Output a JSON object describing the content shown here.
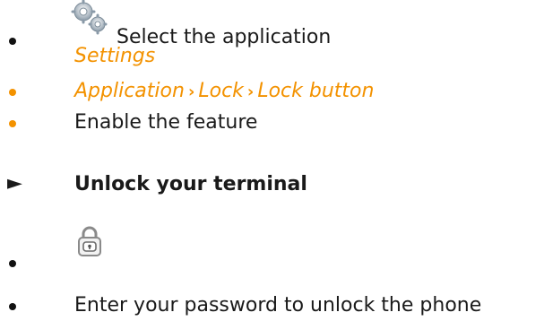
{
  "steps": [
    {
      "prefix": "Select the application",
      "app_name": "Settings",
      "icon": "gears-icon"
    },
    {
      "path": [
        "Application",
        "Lock",
        "Lock button"
      ],
      "separator": "›"
    },
    {
      "text": "Enable the feature"
    }
  ],
  "section": {
    "title": "Unlock your terminal",
    "marker": "►"
  },
  "section_steps": [
    {
      "icon": "padlock-icon"
    },
    {
      "text": "Enter your password to unlock the phone"
    }
  ],
  "colors": {
    "accent": "#f39200",
    "bullet_black": "#111111",
    "text": "#1a1a1a"
  }
}
